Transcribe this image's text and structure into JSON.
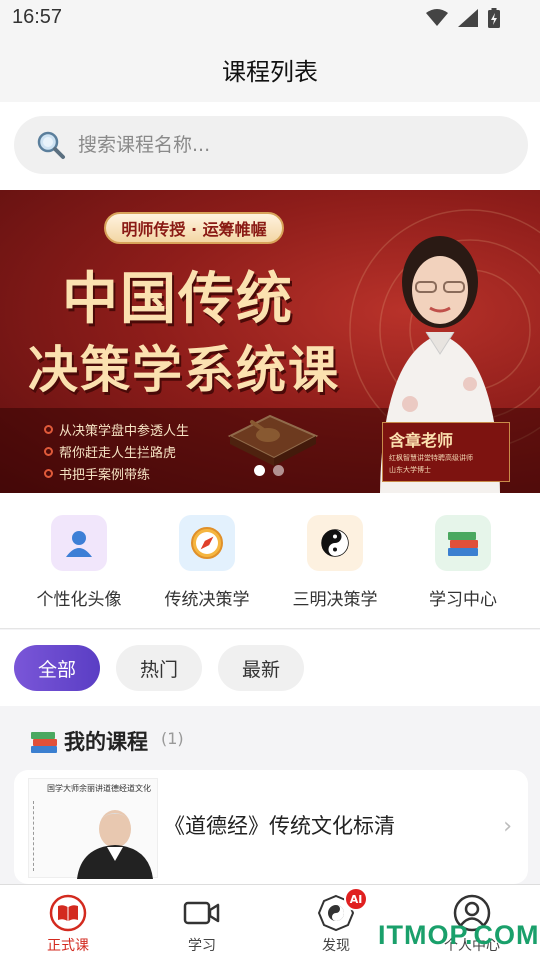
{
  "status_bar": {
    "time": "16:57"
  },
  "header": {
    "title": "课程列表"
  },
  "search": {
    "placeholder": "搜索课程名称..."
  },
  "banner": {
    "pill": "明师传授 · 运筹帷幄",
    "title_line1": "中国传统",
    "title_line2": "决策学系统课",
    "bullets": [
      "从决策学盘中参透人生",
      "帮你赶走人生拦路虎",
      "书把手案例带练"
    ],
    "teacher_name": "含章老师",
    "teacher_line1": "红枫智慧讲堂特聘高级讲师",
    "teacher_line2": "山东大学博士",
    "active_slide": 1,
    "slide_count": 2
  },
  "quick_nav": [
    {
      "label": "个性化头像",
      "icon": "person-icon",
      "bg": "#f1e6fb"
    },
    {
      "label": "传统决策学",
      "icon": "compass-icon",
      "bg": "#e3f1fd"
    },
    {
      "label": "三明决策学",
      "icon": "yin-yang-icon",
      "bg": "#fdf1e0"
    },
    {
      "label": "学习中心",
      "icon": "books-icon",
      "bg": "#e6f5ea"
    }
  ],
  "tabs": [
    {
      "label": "全部",
      "active": true
    },
    {
      "label": "热门",
      "active": false
    },
    {
      "label": "最新",
      "active": false
    }
  ],
  "my_courses": {
    "title": "我的课程",
    "count": "(1)",
    "items": [
      {
        "title": "《道德经》传统文化标清",
        "thumb_caption": "国学大师余丽讲道德经道文化"
      }
    ]
  },
  "tab_bar": [
    {
      "label": "正式课",
      "icon": "book-icon",
      "active": true
    },
    {
      "label": "学习",
      "icon": "video-icon",
      "active": false
    },
    {
      "label": "发现",
      "icon": "bagua-icon",
      "active": false,
      "badge": "AI"
    },
    {
      "label": "个人中心",
      "icon": "user-icon",
      "active": false
    }
  ],
  "watermark": "ITMOP.COM",
  "colors": {
    "accent": "#5a3ec4",
    "active_tab": "#d32a1f",
    "banner_red": "#8e1d1a"
  }
}
